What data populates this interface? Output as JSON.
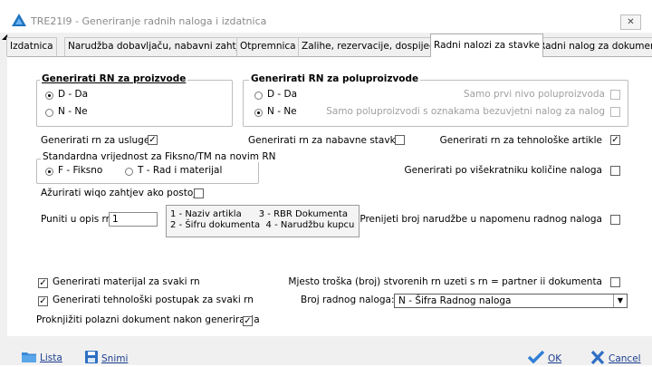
{
  "window": {
    "title": "TRE21I9 - Generiranje radnih naloga i izdatnica",
    "close_label": "✕"
  },
  "tabs": [
    {
      "label": "Izdatnica",
      "active": false
    },
    {
      "label": "Narudžba dobavljaču, nabavni zahtjev",
      "active": false
    },
    {
      "label": "Otpremnica",
      "active": false
    },
    {
      "label": "Zalihe, rezervacije, dospijeće",
      "active": false
    },
    {
      "label": "Radni nalozi za stavke",
      "active": true
    },
    {
      "label": "Radni nalog za dokument",
      "active": false
    }
  ],
  "group_proizvode": {
    "title": "Generirati RN za proizvode",
    "options": [
      {
        "label": "D - Da",
        "selected": true
      },
      {
        "label": "N - Ne",
        "selected": false
      }
    ]
  },
  "group_poluproizvode": {
    "title": "Generirati RN za poluproizvode",
    "options": [
      {
        "label": "D - Da",
        "selected": false
      },
      {
        "label": "N - Ne",
        "selected": true
      }
    ],
    "prvi_nivo_label": "Samo prvi nivo poluproizvoda",
    "prvi_nivo_checked": false,
    "bezuvjetni_label": "Samo poluproizvodi s oznakama bezuvjetni nalog za nalog",
    "bezuvjetni_checked": false
  },
  "usluge": {
    "label": "Generirati rn za usluge",
    "checked": true
  },
  "nabavne": {
    "label": "Generirati rn za nabavne stavke",
    "checked": false
  },
  "tehnoloske": {
    "label": "Generirati rn za tehnološke artikle",
    "checked": true
  },
  "standardna": {
    "title": "Standardna vrijednost za Fiksno/TM na novim RN",
    "options": [
      {
        "label": "F - Fiksno",
        "selected": true
      },
      {
        "label": "T - Rad i materijal",
        "selected": false
      }
    ]
  },
  "visekratniku": {
    "label": "Generirati po višekratniku količine naloga",
    "checked": false
  },
  "azurirati": {
    "label": "Ažurirati wiqo zahtjev ako postoji",
    "checked": false
  },
  "opis": {
    "label": "Puniti u opis rn:",
    "value": "1",
    "legend_line1": "1 - Naziv artikla      3 - RBR Dokumenta",
    "legend_line2": "2 - Šifru dokumenta  4 - Narudžbu kupcu"
  },
  "prenijeti": {
    "label": "Prenijeti broj narudžbe u napomenu radnog naloga",
    "checked": false
  },
  "materijal": {
    "label": "Generirati materijal za svaki rn",
    "checked": true
  },
  "tehnoloski_postupak": {
    "label": "Generirati tehnološki postupak za svaki rn",
    "checked": true
  },
  "proknjiziti": {
    "label": "Proknjižiti polazni dokument nakon generiranja",
    "checked": true
  },
  "mjesto_troska": {
    "label": "Mjesto troška (broj) stvorenih rn uzeti s rn = partner ii dokumenta",
    "checked": false
  },
  "broj_naloga": {
    "label": "Broj radnog naloga:",
    "value": "N - Šifra Radnog naloga"
  },
  "footer": {
    "lista": "Lista",
    "snimi": "Snimi",
    "ok": "OK",
    "cancel": "Cancel"
  },
  "icons": {
    "app": "triangle-logo-icon",
    "lista": "folder-icon",
    "snimi": "save-icon",
    "ok": "checkmark-icon",
    "cancel": "x-icon"
  },
  "colors": {
    "app_icon": "#1e73be",
    "ok_check": "#2f7fd6",
    "cancel_x": "#2f6fc4",
    "folder": "#3a87d6"
  }
}
